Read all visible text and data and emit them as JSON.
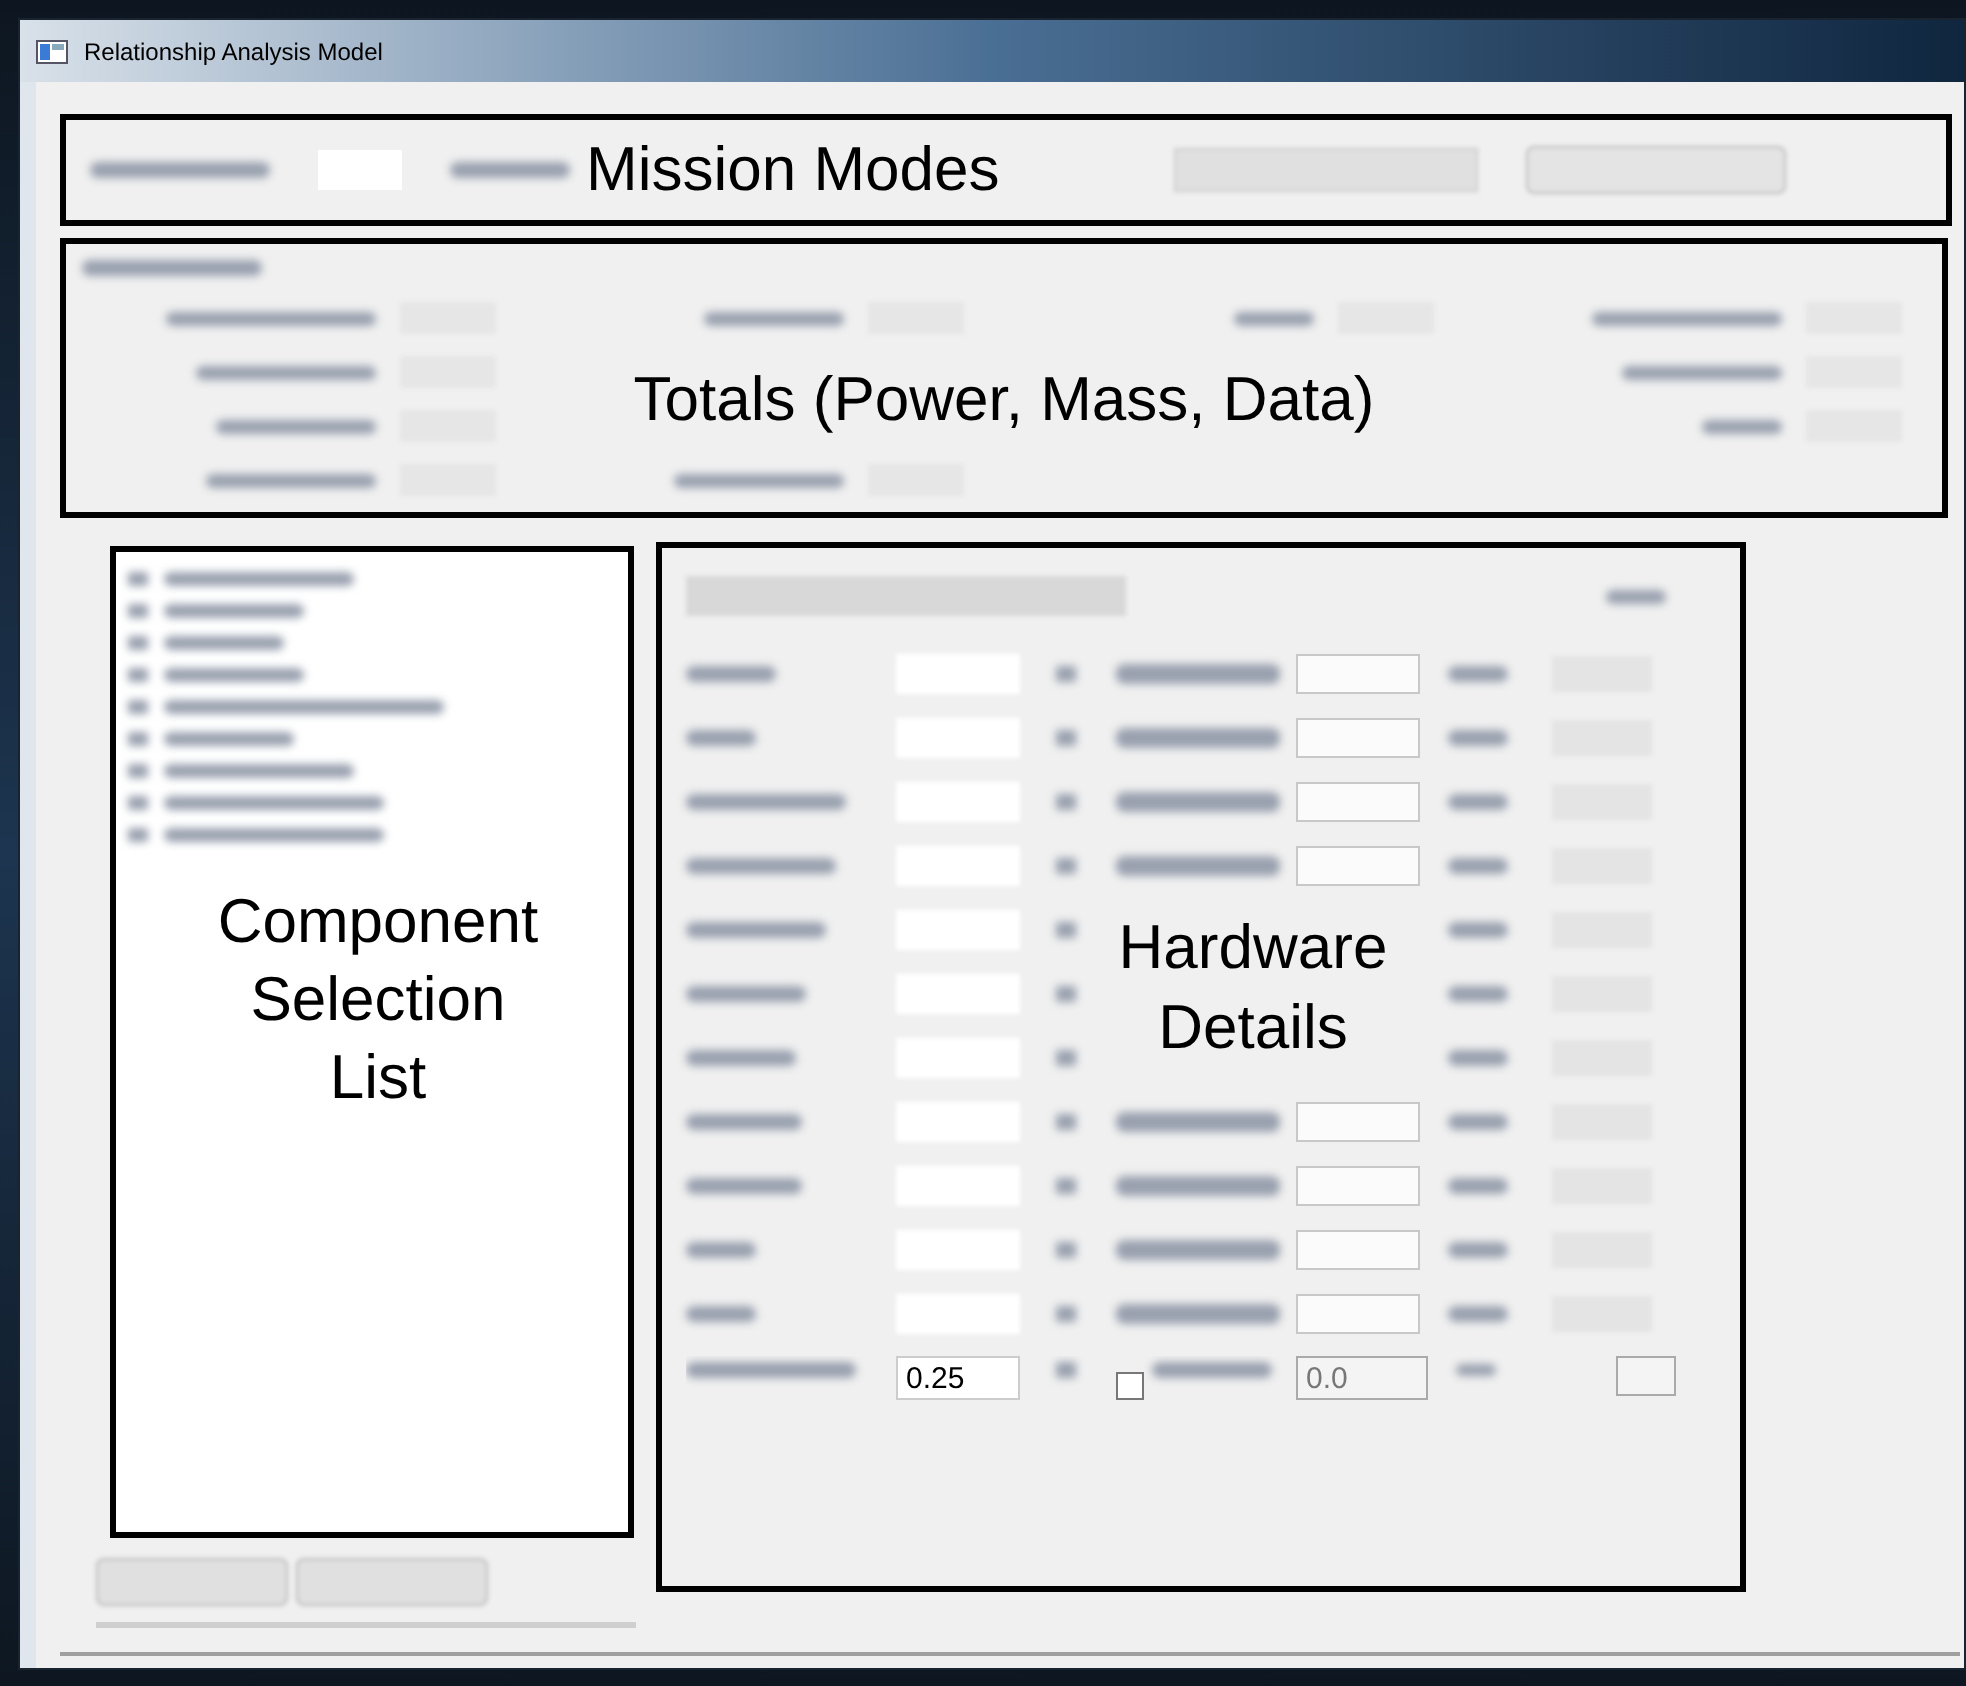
{
  "window": {
    "title": "Relationship Analysis Model"
  },
  "annotations": [
    {
      "text": "Mission Modes"
    },
    {
      "text": "Totals (Power, Mass, Data)"
    },
    {
      "text": "Component Selection List"
    },
    {
      "text": "Hardware Details"
    }
  ],
  "hardware_details": {
    "last_row": {
      "value": "0.25",
      "constant": false,
      "constant_value": "0.0"
    }
  }
}
